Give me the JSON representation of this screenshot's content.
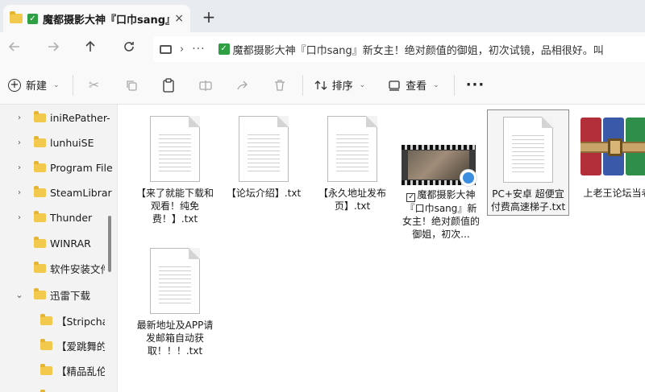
{
  "tab": {
    "title": "魔都摄影大神『口巾sang』",
    "close_glyph": "×",
    "new_tab_glyph": "+"
  },
  "address_bar": {
    "path": "魔都摄影大神『口巾sang』新女主！绝对颜值的御姐，初次试镜，品相很好。叫",
    "separator": "›",
    "overflow": "···"
  },
  "toolbar": {
    "new_label": "新建",
    "sort_label": "排序",
    "view_label": "查看",
    "more_glyph": "···"
  },
  "sidebar": {
    "items": [
      {
        "label": "iniRePather-",
        "expandable": true
      },
      {
        "label": "lunhuiSE",
        "expandable": true
      },
      {
        "label": "Program File",
        "expandable": true
      },
      {
        "label": "SteamLibrar",
        "expandable": true
      },
      {
        "label": "Thunder",
        "expandable": true
      },
      {
        "label": "WINRAR",
        "expandable": false
      },
      {
        "label": "软件安装文件",
        "expandable": false
      },
      {
        "label": "迅雷下载",
        "expandable": true,
        "expanded": true
      },
      {
        "label": "【Stripchat",
        "expandable": false
      },
      {
        "label": "【爱跳舞的",
        "expandable": false
      },
      {
        "label": "【精品乱伦",
        "expandable": false
      }
    ]
  },
  "files": [
    {
      "name": "【来了就能下载和观看！纯免费！】.txt",
      "type": "txt"
    },
    {
      "name": "【论坛介绍】.txt",
      "type": "txt"
    },
    {
      "name": "【永久地址发布页】.txt",
      "type": "txt"
    },
    {
      "name": "魔都摄影大神『口巾sang』新女主！绝对颜值的御姐，初次...",
      "type": "folder-video",
      "checked": true
    },
    {
      "name": "PC+安卓 超便宜付费高速梯子.txt",
      "type": "txt",
      "selected": true
    },
    {
      "name": "上老王论坛当老王.zip",
      "type": "zip"
    },
    {
      "name": "最新地址及APP请发邮箱自动获取！！！.txt",
      "type": "txt"
    }
  ],
  "labels": {
    "f0": "【来了就能下载和观看！纯免费！】.txt",
    "f1": "【论坛介绍】.txt",
    "f2": "【永久地址发布页】.txt",
    "f3": "魔都摄影大神『口巾sang』新女主！绝对颜值的御姐，初次...",
    "f4": "PC+安卓 超便宜付费高速梯子.txt",
    "f5": "上老王论坛当老王.zip",
    "f6": "最新地址及APP请发邮箱自动获取！！！.txt"
  },
  "colors": {
    "folder": "#f2c94c",
    "check_green": "#2ea043",
    "selection_border": "#8a8a8a"
  }
}
